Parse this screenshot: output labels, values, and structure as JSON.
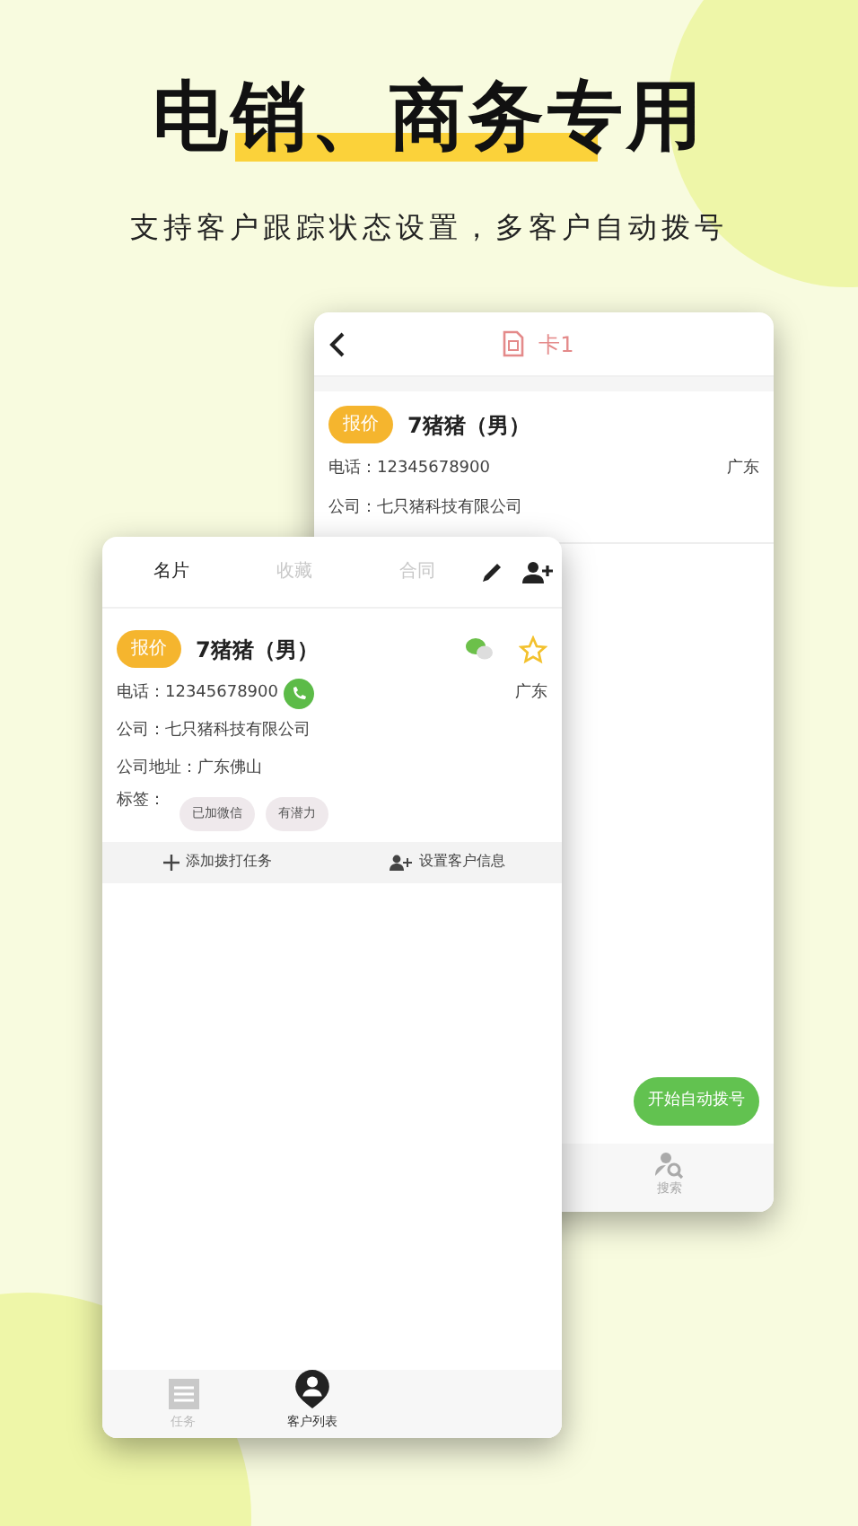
{
  "headline": {
    "title": "电销、商务专用",
    "subtitle": "支持客户跟踪状态设置，多客户自动拨号"
  },
  "back_screen": {
    "header": {
      "title": "卡1"
    },
    "card": {
      "tag": "报价",
      "name": "7猪猪（男）",
      "phone": "电话：12345678900",
      "region": "广东",
      "company": "公司：七只猪科技有限公司"
    },
    "auto_dial_button": "开始自动拨号",
    "nav": [
      {
        "label": "搜索",
        "selected": false
      }
    ]
  },
  "front_screen": {
    "tabs": [
      {
        "label": "名片",
        "selected": true
      },
      {
        "label": "收藏",
        "selected": false
      },
      {
        "label": "合同",
        "selected": false
      }
    ],
    "card": {
      "tag": "报价",
      "name": "7猪猪（男）",
      "starred": false,
      "phone": "电话：12345678900",
      "region": "广东",
      "company": "公司：七只猪科技有限公司",
      "address": "公司地址：广东佛山",
      "tags_label": "标签：",
      "tags": [
        "已加微信",
        "有潜力"
      ]
    },
    "actions": [
      {
        "kind": "add",
        "label": "添加拨打任务"
      },
      {
        "kind": "person",
        "label": "设置客户信息"
      }
    ],
    "nav": [
      {
        "kind": "list",
        "label": "任务",
        "selected": false
      },
      {
        "kind": "customer",
        "label": "客户列表",
        "selected": true
      }
    ]
  }
}
